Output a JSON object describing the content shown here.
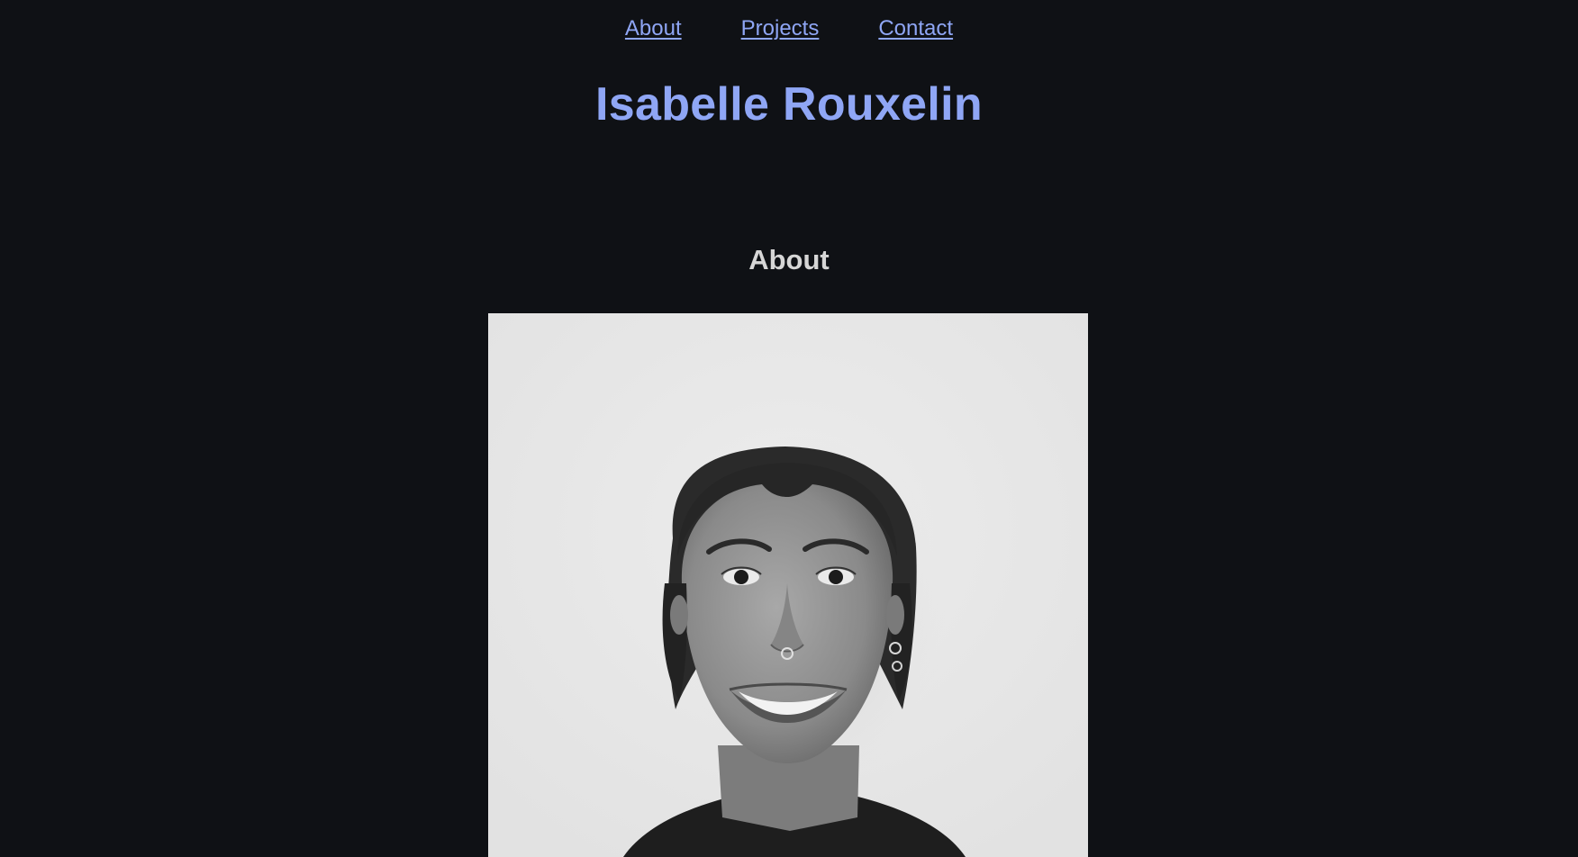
{
  "nav": {
    "items": [
      {
        "label": "About"
      },
      {
        "label": "Projects"
      },
      {
        "label": "Contact"
      }
    ]
  },
  "header": {
    "title": "Isabelle Rouxelin"
  },
  "about": {
    "heading": "About",
    "photo": {
      "kind": "portrait-photo",
      "style": "grayscale",
      "background": "#e8e8e8"
    }
  },
  "colors": {
    "page_background": "#0f1115",
    "accent": "#8fa6f5",
    "heading_text": "#d6d6d6"
  }
}
